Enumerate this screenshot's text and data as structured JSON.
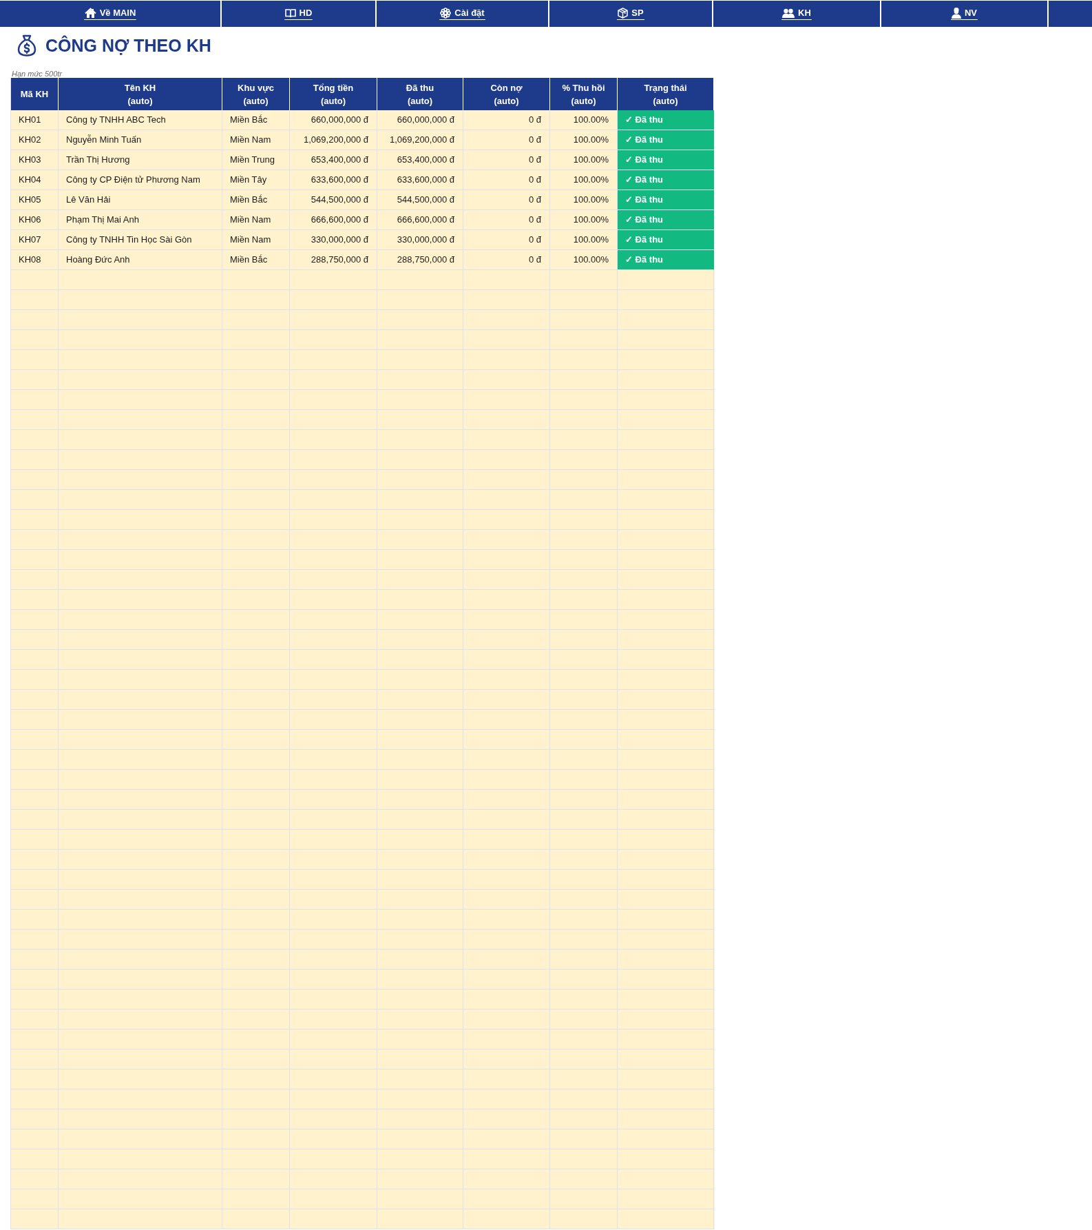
{
  "nav": [
    {
      "label": "Về MAIN"
    },
    {
      "label": "HD"
    },
    {
      "label": "Cài đặt"
    },
    {
      "label": "SP"
    },
    {
      "label": "KH"
    },
    {
      "label": "NV"
    }
  ],
  "title": "CÔNG NỢ THEO KH",
  "note": "Hạn mức 500tr",
  "table": {
    "columns": [
      {
        "label": "Mã KH"
      },
      {
        "label": "Tên KH\n(auto)"
      },
      {
        "label": "Khu vực\n(auto)"
      },
      {
        "label": "Tổng tiền\n(auto)"
      },
      {
        "label": "Đã thu\n(auto)"
      },
      {
        "label": "Còn nợ\n(auto)"
      },
      {
        "label": "% Thu hồi\n(auto)"
      },
      {
        "label": "Trạng thái\n(auto)"
      }
    ],
    "rows": [
      {
        "cells": [
          "KH01",
          "Công ty TNHH ABC Tech",
          "Miền Bắc",
          "660,000,000 đ",
          "660,000,000 đ",
          "0 đ",
          "100.00%",
          "✓ Đã thu"
        ]
      },
      {
        "cells": [
          "KH02",
          "Nguyễn Minh Tuấn",
          "Miền Nam",
          "1,069,200,000 đ",
          "1,069,200,000 đ",
          "0 đ",
          "100.00%",
          "✓ Đã thu"
        ]
      },
      {
        "cells": [
          "KH03",
          "Trần Thị Hương",
          "Miền Trung",
          "653,400,000 đ",
          "653,400,000 đ",
          "0 đ",
          "100.00%",
          "✓ Đã thu"
        ]
      },
      {
        "cells": [
          "KH04",
          "Công ty CP Điện tử Phương Nam",
          "Miền Tây",
          "633,600,000 đ",
          "633,600,000 đ",
          "0 đ",
          "100.00%",
          "✓ Đã thu"
        ]
      },
      {
        "cells": [
          "KH05",
          "Lê Văn Hải",
          "Miền Bắc",
          "544,500,000 đ",
          "544,500,000 đ",
          "0 đ",
          "100.00%",
          "✓ Đã thu"
        ]
      },
      {
        "cells": [
          "KH06",
          "Phạm Thị Mai Anh",
          "Miền Nam",
          "666,600,000 đ",
          "666,600,000 đ",
          "0 đ",
          "100.00%",
          "✓ Đã thu"
        ]
      },
      {
        "cells": [
          "KH07",
          "Công ty TNHH Tin Học Sài Gòn",
          "Miền Nam",
          "330,000,000 đ",
          "330,000,000 đ",
          "0 đ",
          "100.00%",
          "✓ Đã thu"
        ]
      },
      {
        "cells": [
          "KH08",
          "Hoàng Đức Anh",
          "Miền Bắc",
          "288,750,000 đ",
          "288,750,000 đ",
          "0 đ",
          "100.00%",
          "✓ Đã thu"
        ]
      }
    ]
  }
}
